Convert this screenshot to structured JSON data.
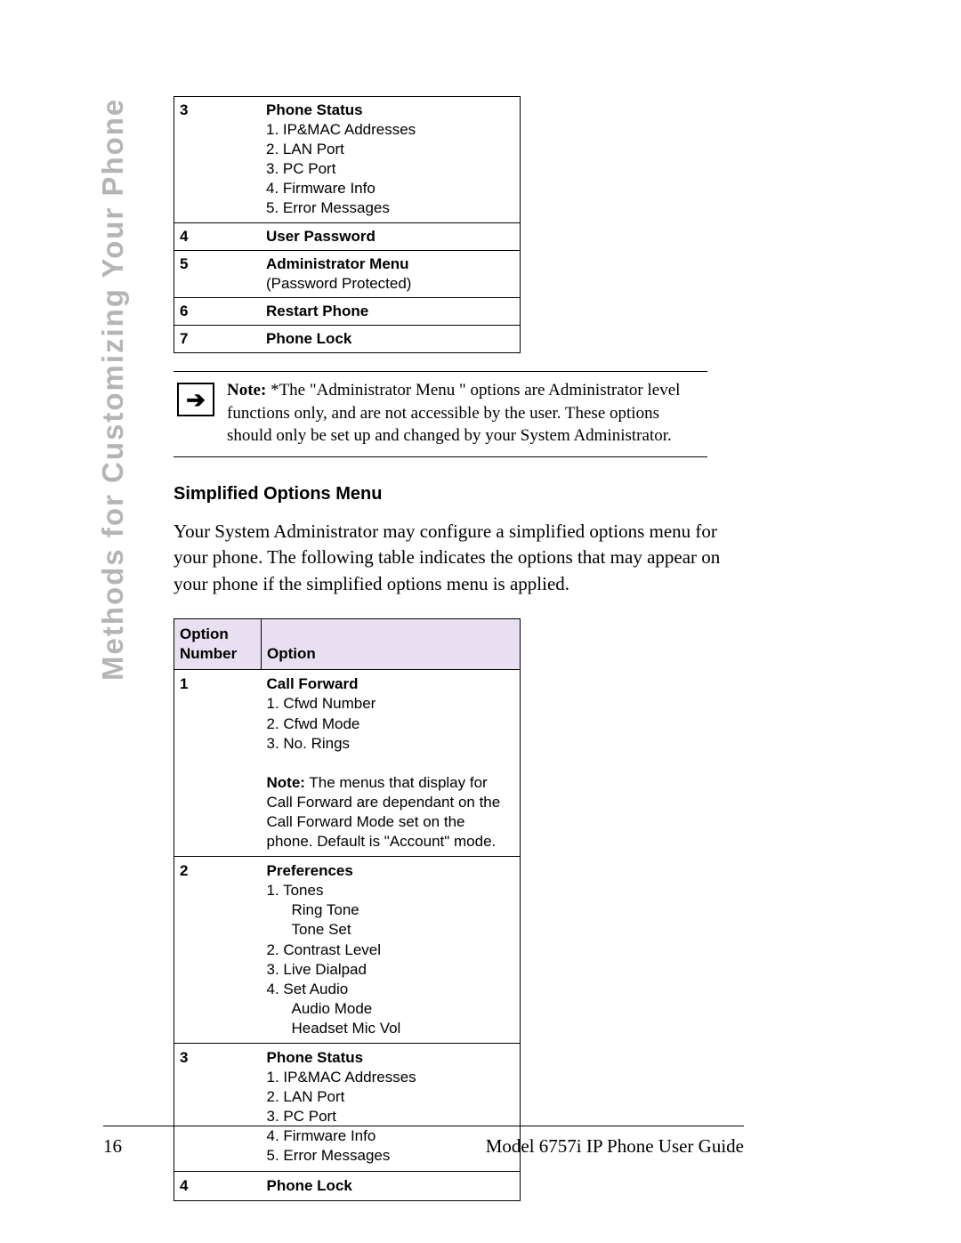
{
  "side_title": "Methods for Customizing Your Phone",
  "table1": {
    "rows": [
      {
        "num": "3",
        "title": "Phone Status",
        "lines": [
          "1. IP&MAC Addresses",
          "2. LAN Port",
          "3. PC Port",
          "4. Firmware Info",
          "5. Error Messages"
        ]
      },
      {
        "num": "4",
        "title": "User Password"
      },
      {
        "num": "5",
        "title": "Administrator Menu",
        "lines": [
          "(Password Protected)"
        ]
      },
      {
        "num": "6",
        "title": "Restart Phone"
      },
      {
        "num": "7",
        "title": "Phone Lock"
      }
    ]
  },
  "note": {
    "label": "Note: ",
    "body": "*The \"Administrator Menu \" options are Administrator level functions only, and are not accessible by the user. These options should only be set up and changed by your System Administrator."
  },
  "heading2": "Simplified Options Menu",
  "paragraph": "Your System Administrator may configure a simplified options menu for your phone. The following table indicates the options that may appear on your phone if the simplified options menu is applied.",
  "table2": {
    "headers": [
      "Option Number",
      "Option"
    ],
    "rows": [
      {
        "num": "1",
        "title": "Call Forward",
        "lines": [
          "1. Cfwd Number",
          "2. Cfwd Mode",
          "3. No. Rings"
        ],
        "note_label": "Note:",
        "note_body": "The menus that display for Call Forward are dependant on the Call Forward Mode set on the phone. Default is \"Account\" mode."
      },
      {
        "num": "2",
        "title": "Preferences",
        "lines": [
          "1. Tones",
          "2. Contrast Level",
          "3. Live Dialpad",
          "4. Set Audio"
        ],
        "sublines1": [
          "Ring Tone",
          "Tone Set"
        ],
        "sublines4": [
          "Audio Mode",
          "Headset Mic Vol"
        ]
      },
      {
        "num": "3",
        "title": "Phone Status",
        "lines": [
          "1. IP&MAC Addresses",
          "2. LAN Port",
          "3. PC Port",
          "4. Firmware Info",
          "5. Error Messages"
        ]
      },
      {
        "num": "4",
        "title": "Phone Lock"
      }
    ]
  },
  "footer": {
    "page": "16",
    "title": "Model 6757i IP Phone User Guide"
  }
}
